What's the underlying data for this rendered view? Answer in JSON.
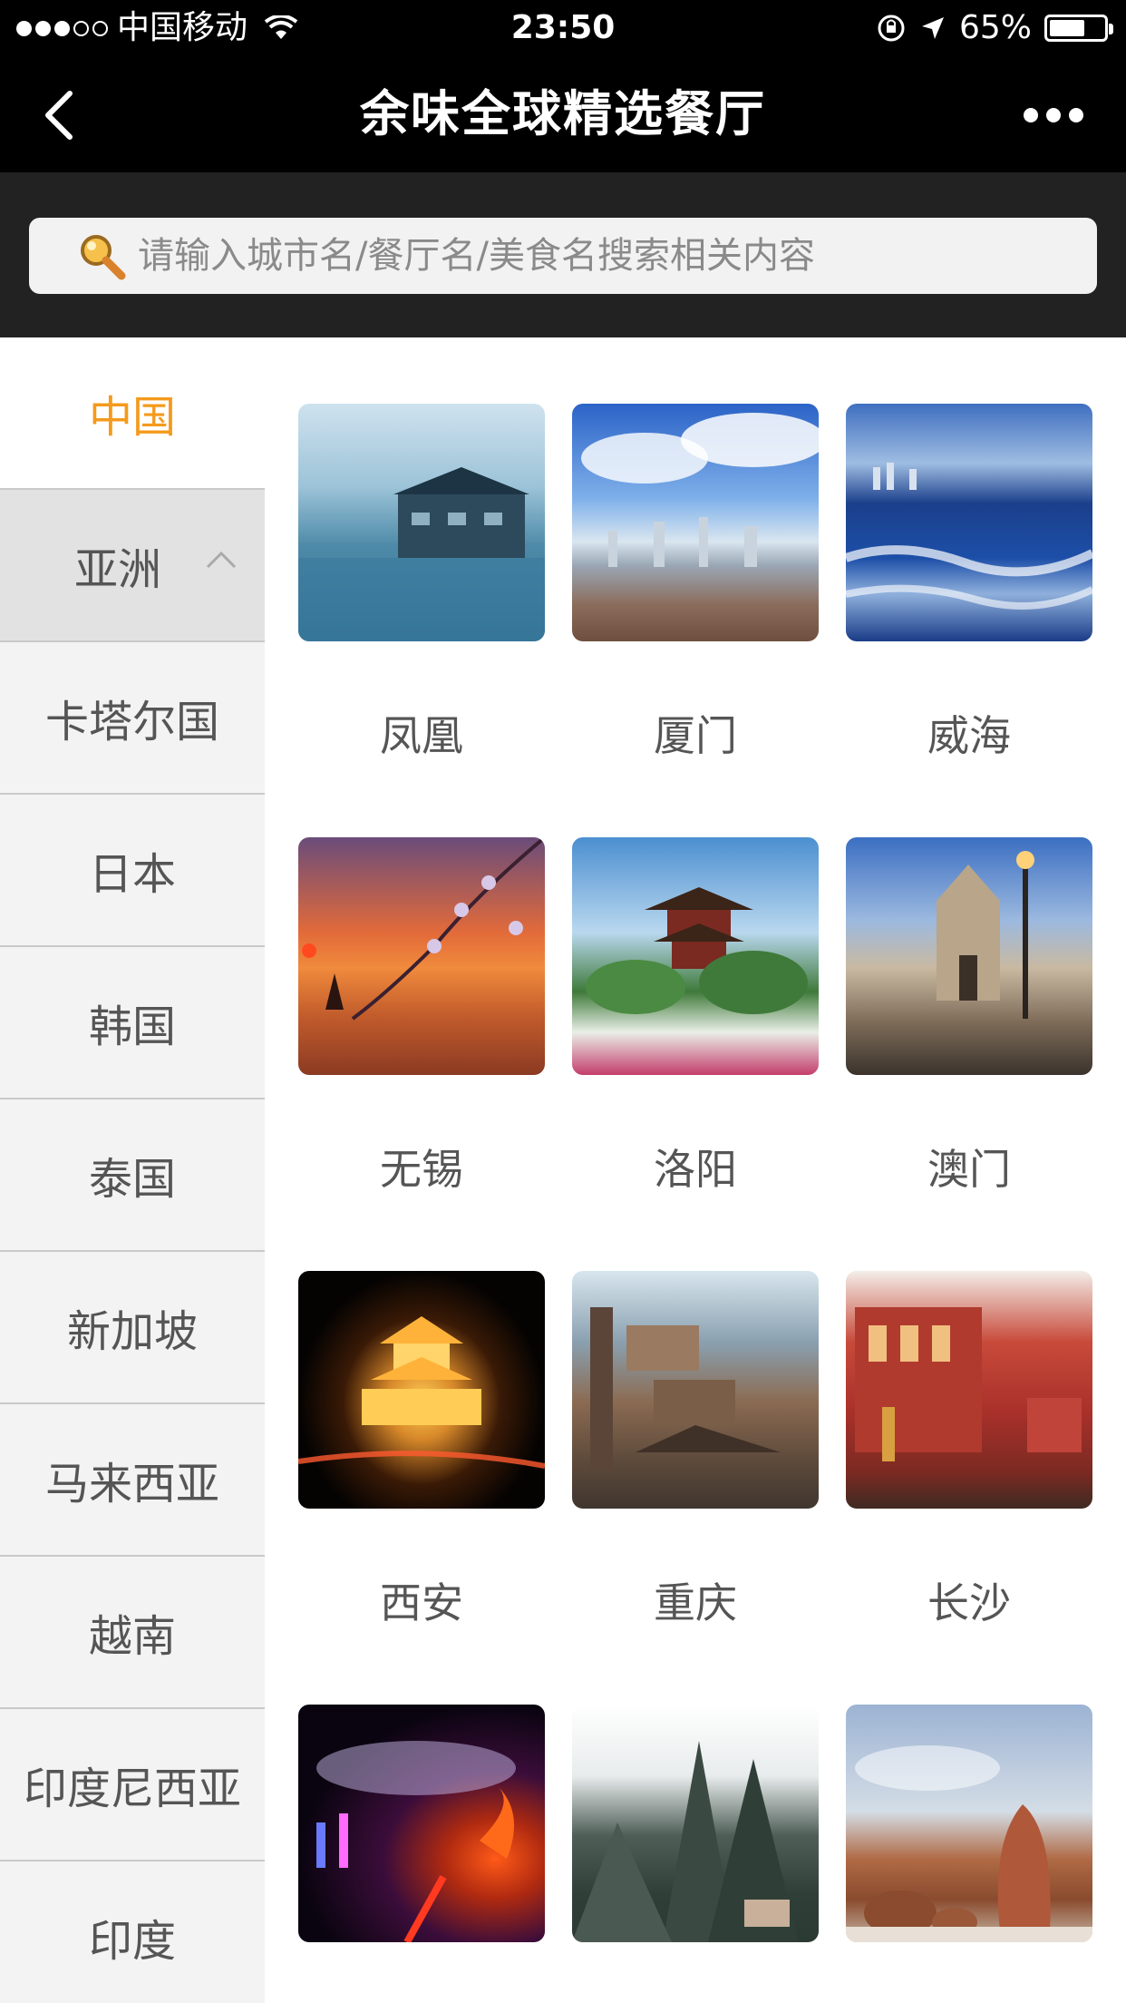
{
  "status_bar": {
    "carrier": "中国移动",
    "time": "23:50",
    "battery": "65%",
    "battery_level": 0.65
  },
  "nav": {
    "title": "余味全球精选餐厅"
  },
  "search": {
    "placeholder": "请输入城市名/餐厅名/美食名搜索相关内容"
  },
  "sidebar": {
    "items": [
      {
        "label": "中国",
        "state": "selected"
      },
      {
        "label": "亚洲",
        "state": "expanded"
      },
      {
        "label": "卡塔尔国"
      },
      {
        "label": "日本"
      },
      {
        "label": "韩国"
      },
      {
        "label": "泰国"
      },
      {
        "label": "新加坡"
      },
      {
        "label": "马来西亚"
      },
      {
        "label": "越南"
      },
      {
        "label": "印度尼西亚"
      },
      {
        "label": "印度"
      }
    ]
  },
  "cities": [
    {
      "name": "凤凰",
      "image": "fenghuang"
    },
    {
      "name": "厦门",
      "image": "xiamen"
    },
    {
      "name": "威海",
      "image": "weihai"
    },
    {
      "name": "无锡",
      "image": "wuxi"
    },
    {
      "name": "洛阳",
      "image": "luoyang"
    },
    {
      "name": "澳门",
      "image": "macau"
    },
    {
      "name": "西安",
      "image": "xian"
    },
    {
      "name": "重庆",
      "image": "chongqing"
    },
    {
      "name": "长沙",
      "image": "changsha"
    },
    {
      "name": "",
      "image": "qingdao"
    },
    {
      "name": "",
      "image": "mountain"
    },
    {
      "name": "",
      "image": "sanya"
    }
  ],
  "colors": {
    "accent": "#f49a1c",
    "header_bg": "#000000",
    "search_bg": "#222222",
    "sidebar_bg": "#f3f3f3"
  }
}
